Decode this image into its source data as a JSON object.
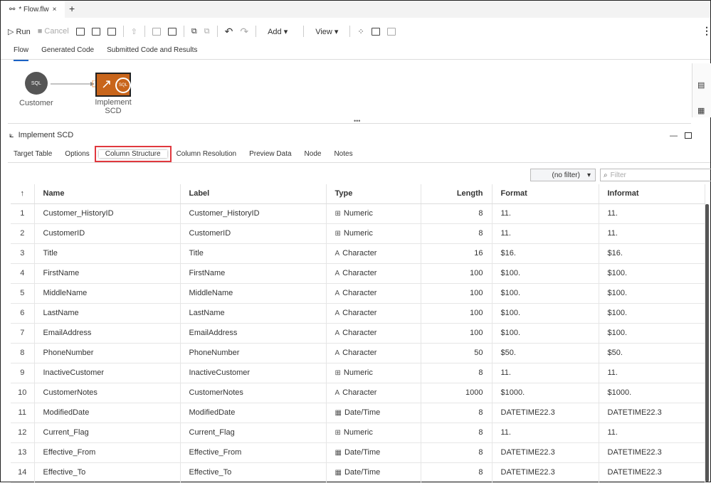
{
  "tab": {
    "title": "* Flow.flw",
    "close": "×",
    "add": "+"
  },
  "toolbar": {
    "run": "Run",
    "cancel": "Cancel",
    "add": "Add",
    "view": "View"
  },
  "subtabs": [
    "Flow",
    "Generated Code",
    "Submitted Code and Results"
  ],
  "flow": {
    "nodes": [
      {
        "label": "Customer",
        "badge": "SQL"
      },
      {
        "label": "Implement SCD",
        "badge": "SQL"
      }
    ]
  },
  "panel": {
    "title": "Implement SCD",
    "tabs": [
      "Target Table",
      "Options",
      "Column Structure",
      "Column Resolution",
      "Preview Data",
      "Node",
      "Notes"
    ],
    "active_tab": "Column Structure"
  },
  "filter": {
    "select": "(no filter)",
    "placeholder": "Filter"
  },
  "table": {
    "headers": [
      "↑",
      "Name",
      "Label",
      "Type",
      "Length",
      "Format",
      "Informat"
    ],
    "rows": [
      [
        "1",
        "Customer_HistoryID",
        "Customer_HistoryID",
        "Numeric",
        "8",
        "11.",
        "11."
      ],
      [
        "2",
        "CustomerID",
        "CustomerID",
        "Numeric",
        "8",
        "11.",
        "11."
      ],
      [
        "3",
        "Title",
        "Title",
        "Character",
        "16",
        "$16.",
        "$16."
      ],
      [
        "4",
        "FirstName",
        "FirstName",
        "Character",
        "100",
        "$100.",
        "$100."
      ],
      [
        "5",
        "MiddleName",
        "MiddleName",
        "Character",
        "100",
        "$100.",
        "$100."
      ],
      [
        "6",
        "LastName",
        "LastName",
        "Character",
        "100",
        "$100.",
        "$100."
      ],
      [
        "7",
        "EmailAddress",
        "EmailAddress",
        "Character",
        "100",
        "$100.",
        "$100."
      ],
      [
        "8",
        "PhoneNumber",
        "PhoneNumber",
        "Character",
        "50",
        "$50.",
        "$50."
      ],
      [
        "9",
        "InactiveCustomer",
        "InactiveCustomer",
        "Numeric",
        "8",
        "11.",
        "11."
      ],
      [
        "10",
        "CustomerNotes",
        "CustomerNotes",
        "Character",
        "1000",
        "$1000.",
        "$1000."
      ],
      [
        "11",
        "ModifiedDate",
        "ModifiedDate",
        "Date/Time",
        "8",
        "DATETIME22.3",
        "DATETIME22.3"
      ],
      [
        "12",
        "Current_Flag",
        "Current_Flag",
        "Numeric",
        "8",
        "11.",
        "11."
      ],
      [
        "13",
        "Effective_From",
        "Effective_From",
        "Date/Time",
        "8",
        "DATETIME22.3",
        "DATETIME22.3"
      ],
      [
        "14",
        "Effective_To",
        "Effective_To",
        "Date/Time",
        "8",
        "DATETIME22.3",
        "DATETIME22.3"
      ]
    ]
  }
}
